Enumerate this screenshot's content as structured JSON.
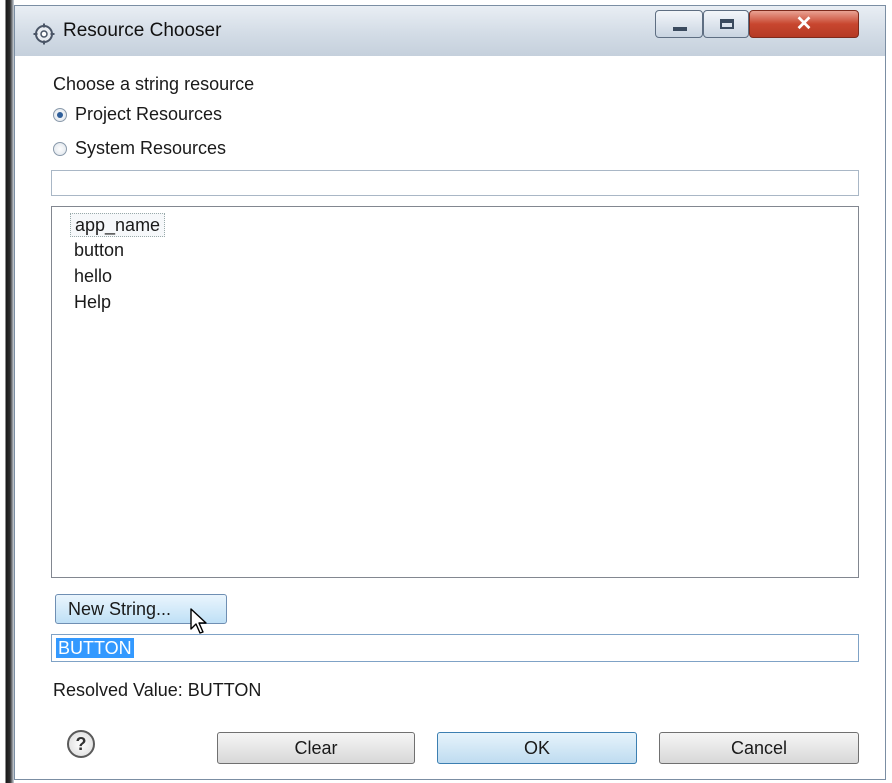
{
  "window": {
    "title": "Resource Chooser",
    "icon": "gear-icon",
    "controls": [
      "minimize-icon",
      "maximize-icon",
      "close-icon"
    ]
  },
  "prompt": "Choose a string resource",
  "source_options": [
    {
      "label": "Project Resources",
      "checked": true
    },
    {
      "label": "System Resources",
      "checked": false
    }
  ],
  "filter": {
    "value": ""
  },
  "resources": [
    {
      "label": "app_name",
      "focused": true
    },
    {
      "label": "button",
      "focused": false
    },
    {
      "label": "hello",
      "focused": false
    },
    {
      "label": "Help",
      "focused": false
    }
  ],
  "new_string_label": "New String...",
  "value_field": {
    "value": "BUTTON"
  },
  "resolved_value": "Resolved Value: BUTTON",
  "buttons": {
    "clear": "Clear",
    "ok": "OK",
    "cancel": "Cancel"
  },
  "colors": {
    "selection": "#3399ff",
    "close_button": "#c8462f",
    "accent": "#2f5f9a"
  }
}
